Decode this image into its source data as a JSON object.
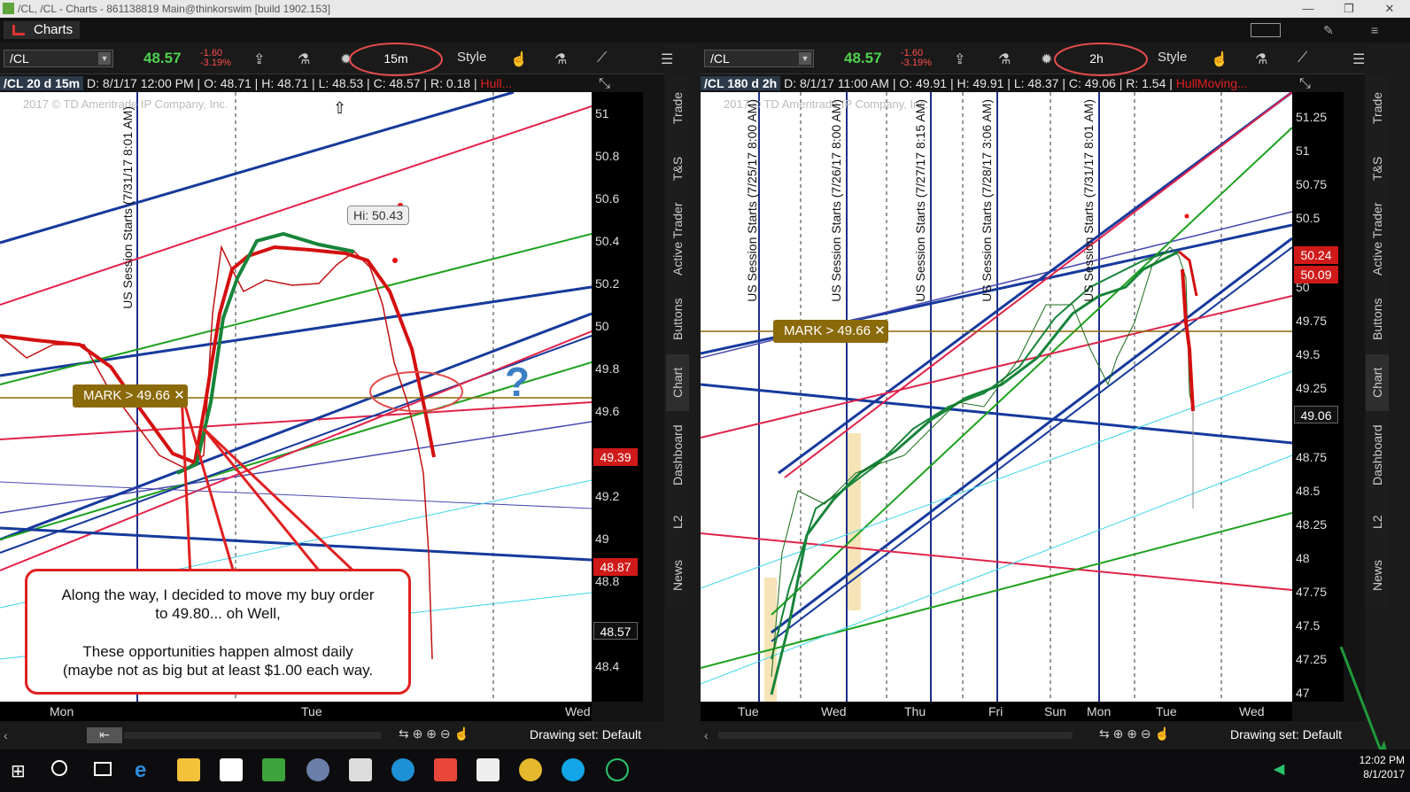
{
  "window": {
    "title": "/CL, /CL - Charts - 861138819 Main@thinkorswim [build 1902.153]",
    "minimize": "—",
    "maximize": "❐",
    "close": "✕"
  },
  "appbar": {
    "tab_label": "Charts",
    "pin": "✎"
  },
  "left": {
    "symbol": "/CL",
    "last": "48.57",
    "change": "-1.60",
    "change_pct": "-3.19%",
    "timeframe": "15m",
    "style_label": "Style",
    "info": {
      "desc": "/CL 20 d 15m",
      "date": "D: 8/1/17 12:00 PM",
      "open": "O: 48.71",
      "high": "H: 48.71",
      "low": "L: 48.53",
      "close": "C: 48.57",
      "range": "R: 0.18",
      "study": "Hull..."
    },
    "copyright": "2017 © TD Ameritrade IP Company, Inc.",
    "session_label": "US Session Starts (7/31/17 8:01 AM)",
    "hi_label": "Hi: 50.43",
    "mark": "MARK > 49.66",
    "question": "?",
    "annotation": {
      "line1": "Along the way, I decided to move my buy order",
      "line2": "to 49.80... oh Well,",
      "line3": "These opportunities happen almost daily",
      "line4": "(maybe not as big but at least $1.00 each way."
    },
    "axis_labels": [
      "51",
      "50.8",
      "50.6",
      "50.4",
      "50.2",
      "50",
      "49.8",
      "49.6",
      "49.2",
      "49",
      "48.8",
      "48.4"
    ],
    "price_boxes": [
      {
        "v": "49.39",
        "c": "#d01a1a"
      },
      {
        "v": "48.87",
        "c": "#d01a1a"
      },
      {
        "v": "48.57",
        "c": "#111"
      }
    ],
    "time_labels": [
      "Mon",
      "Tue",
      "Wed"
    ],
    "drawing_set": "Drawing set: Default"
  },
  "right": {
    "symbol": "/CL",
    "last": "48.57",
    "change": "-1.60",
    "change_pct": "-3.19%",
    "timeframe": "2h",
    "style_label": "Style",
    "info": {
      "desc": "/CL 180 d 2h",
      "date": "D: 8/1/17 11:00 AM",
      "open": "O: 49.91",
      "high": "H: 49.91",
      "low": "L: 48.37",
      "close": "C: 49.06",
      "range": "R: 1.54",
      "study": "HullMoving..."
    },
    "copyright": "2017 © TD Ameritrade IP Company, Inc.",
    "session_labels": [
      "US Session Starts (7/25/17 8:00 AM)",
      "US Session Starts (7/26/17 8:00 AM)",
      "US Session Starts (7/27/17 8:15 AM)",
      "US Session Starts (7/28/17 3:06 AM)",
      "US Session Starts (7/31/17 8:01 AM)"
    ],
    "mark": "MARK > 49.66",
    "axis_labels": [
      "51.25",
      "51",
      "50.75",
      "50.5",
      "50",
      "49.75",
      "49.5",
      "49.25",
      "48.75",
      "48.5",
      "48.25",
      "48",
      "47.75",
      "47.5",
      "47.25",
      "47"
    ],
    "price_boxes": [
      {
        "v": "50.24",
        "c": "#d01a1a"
      },
      {
        "v": "50.09",
        "c": "#d01a1a"
      },
      {
        "v": "49.06",
        "c": "#111"
      }
    ],
    "time_labels": [
      "Tue",
      "Wed",
      "Thu",
      "Fri",
      "Sun",
      "Mon",
      "Tue",
      "Wed"
    ],
    "drawing_set": "Drawing set: Default"
  },
  "side_tabs": [
    "Trade",
    "T&S",
    "Active Trader",
    "Buttons",
    "Chart",
    "Dashboard",
    "L2",
    "News"
  ],
  "taskbar": {
    "time": "12:02 PM",
    "date": "8/1/2017"
  },
  "colors": {
    "accent_red": "#e02020",
    "up": "#1e8a3a",
    "bg": "#141414"
  }
}
